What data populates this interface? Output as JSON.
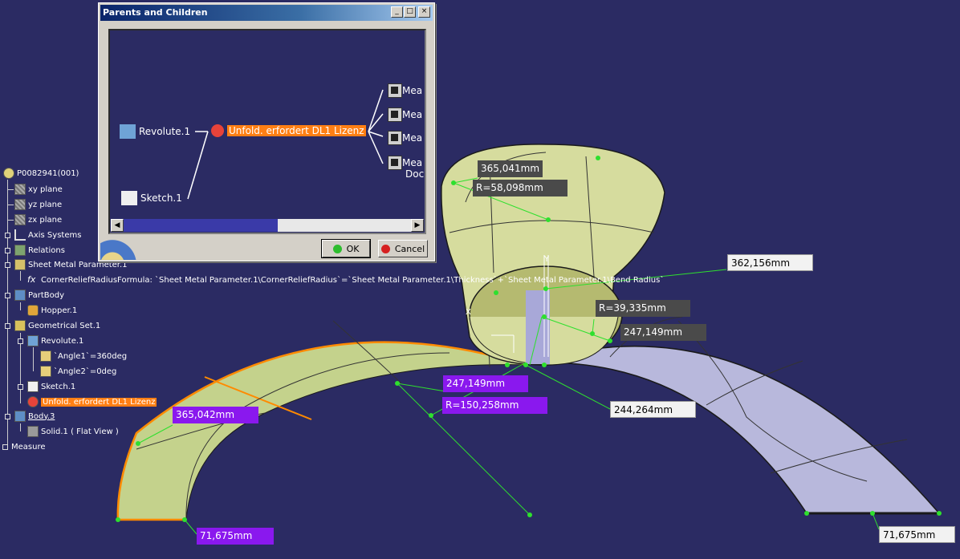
{
  "dialog": {
    "title": "Parents and Children",
    "minimize": "_",
    "maximize": "□",
    "close": "×",
    "parents": [
      "Revolute.1",
      "Sketch.1"
    ],
    "selected_node": "Unfold. erfordert DL1 Lizenz",
    "children": [
      "Mea",
      "Mea",
      "Mea",
      "Mea"
    ],
    "child_extra": "Doc",
    "scroll_left": "◀",
    "scroll_right": "▶",
    "ok_label": "OK",
    "cancel_label": "Cancel"
  },
  "tree": {
    "items": [
      "P0082941(001)",
      "xy plane",
      "yz plane",
      "zx plane",
      "Axis Systems",
      "Relations",
      "Sheet Metal Parameter.1",
      "CornerReliefRadiusFormula",
      "PartBody",
      "Hopper.1",
      "Geometrical Set.1",
      "Revolute.1",
      "`Angle1`=360deg",
      "`Angle2`=0deg",
      "Sketch.1",
      "Unfold. erfordert DL1 Lizenz",
      "Body.3",
      "Solid.1 ( Flat View )",
      "Measure"
    ],
    "formula_text": "CornerReliefRadiusFormula: `Sheet Metal Parameter.1\\CornerReliefRadius`=`Sheet Metal Parameter.1\\Thickness`+`Sheet Metal Parameter.1\\Bend Radius`",
    "fx_glyph": "fx"
  },
  "measures": [
    "365,041mm",
    "R=58,098mm",
    "362,156mm",
    "R=39,335mm",
    "247,149mm",
    "247,149mm",
    "R=150,258mm",
    "244,264mm",
    "365,042mm",
    "71,675mm",
    "71,675mm"
  ],
  "colors": {
    "background": "#2b2b63",
    "flat_green": "#c4d28c",
    "flat_lavender": "#b8b8dc",
    "cone": "#d6dc9e",
    "highlight": "#ff7f14",
    "measure_purple": "#8a18ee"
  }
}
